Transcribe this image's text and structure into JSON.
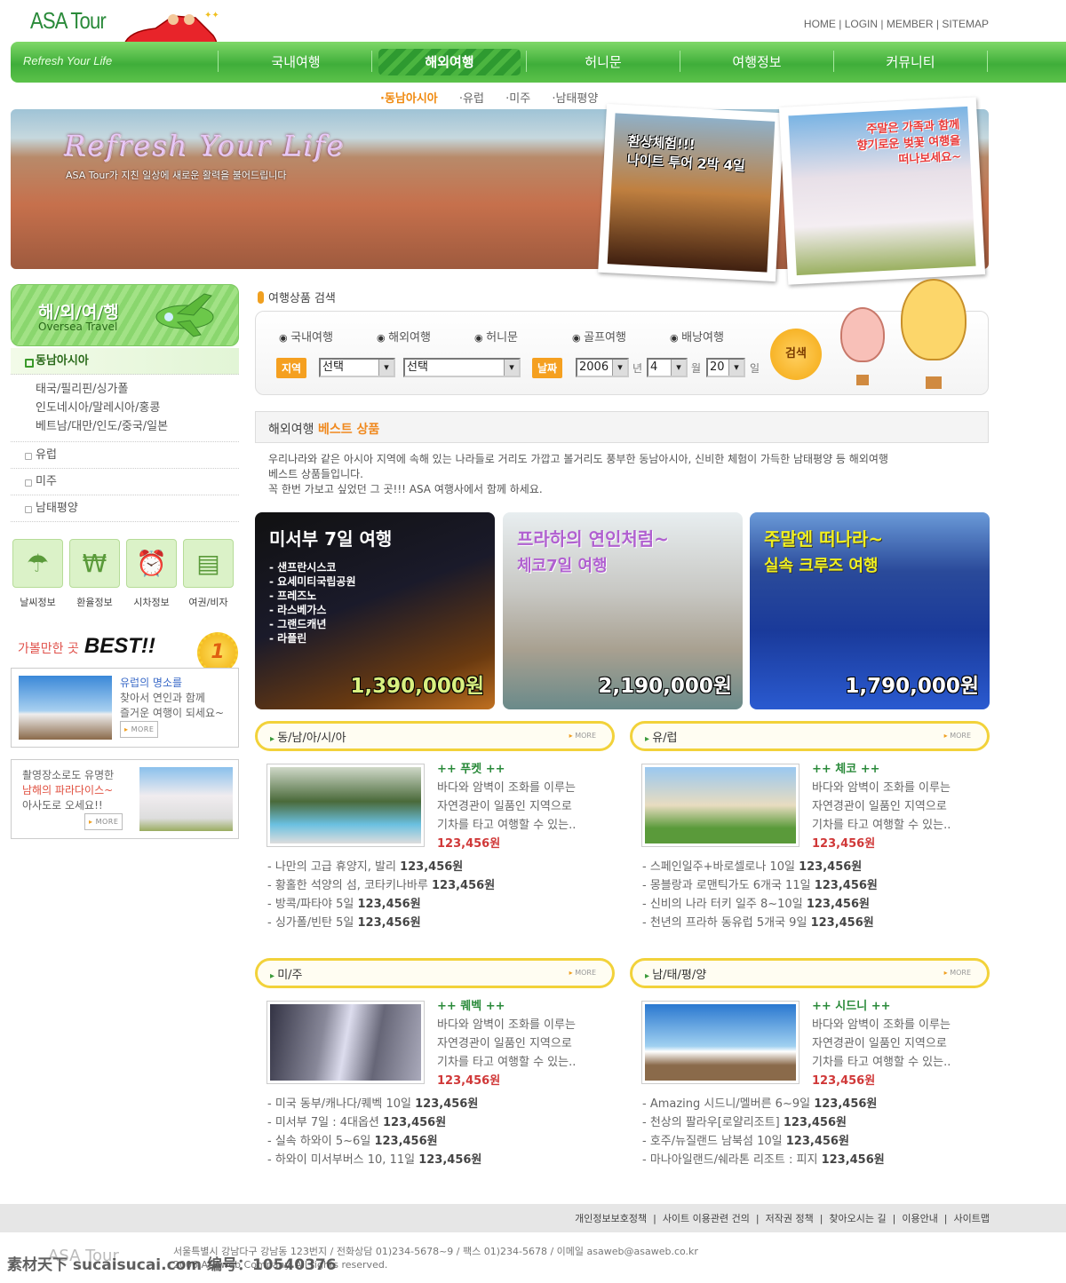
{
  "header": {
    "logo": "ASA Tour",
    "top_links": [
      "HOME",
      "LOGIN",
      "MEMBER",
      "SITEMAP"
    ]
  },
  "nav": {
    "tagline": "Refresh Your Life",
    "items": [
      "국내여행",
      "해외여행",
      "허니문",
      "여행정보",
      "커뮤니티"
    ],
    "active": "해외여행"
  },
  "subnav": [
    "동남아시아",
    "유럽",
    "미주",
    "남태평양"
  ],
  "banner": {
    "title": "Refresh Your Life",
    "subtitle": "ASA Tour가 지친 일상에 새로운 활력을 불어드립니다",
    "photo1": [
      "환상체험!!!",
      "나이트 투어 2박 4일"
    ],
    "photo2": [
      "주말은 가족과 함께",
      "향기로운 벚꽃 여행을",
      "떠나보세요~"
    ]
  },
  "sidebar": {
    "title_ko": "해/외/여/행",
    "title_en": "Oversea Travel",
    "menu": [
      {
        "label": "동남아시아",
        "active": true,
        "sub": [
          "태국/필리핀/싱가폴",
          "인도네시아/말레시아/홍콩",
          "베트남/대만/인도/중국/일본"
        ]
      },
      {
        "label": "유럽"
      },
      {
        "label": "미주"
      },
      {
        "label": "남태평양"
      }
    ],
    "tools": [
      {
        "label": "날씨정보",
        "icon": "umbrella-icon"
      },
      {
        "label": "환율정보",
        "icon": "won-icon"
      },
      {
        "label": "시차정보",
        "icon": "alarm-clock-icon"
      },
      {
        "label": "여권/비자",
        "icon": "passport-icon"
      }
    ],
    "best_title_ko": "가볼만한 곳",
    "best_title_en": "BEST!!",
    "medal": "1",
    "best_cards": [
      {
        "lines": [
          "유럽의 명소를",
          "찾아서 연인과 함께",
          "즐거운 여행이 되세요~"
        ],
        "more": "MORE"
      },
      {
        "lines": [
          "촬영장소로도 유명한",
          "남해의 파라다이스~",
          "아사도로 오세요!!"
        ],
        "more": "MORE"
      }
    ]
  },
  "search": {
    "title": "여행상품 검색",
    "radios": [
      "국내여행",
      "해외여행",
      "허니문",
      "골프여행",
      "배낭여행"
    ],
    "region_label": "지역",
    "region1": "선택",
    "region2": "선택",
    "date_label": "날짜",
    "year": "2006",
    "year_unit": "년",
    "month": "4",
    "month_unit": "월",
    "day": "20",
    "day_unit": "일",
    "button": "검색"
  },
  "best": {
    "title_a": "해외여행",
    "title_b": "베스트 상품",
    "desc": [
      "우리나라와 같은 아시아 지역에 속해 있는 나라들로 거리도 가깝고 볼거리도 풍부한 동남아시아, 신비한 체험이 가득한 남태평양 등 해외여행",
      "베스트 상품들입니다.",
      "꼭 한번 가보고 싶었던 그 곳!!! ASA 여행사에서 함께 하세요."
    ]
  },
  "cards": [
    {
      "title": "미서부 7일 여행",
      "lines": [
        "- 샌프란시스코",
        "- 요세미티국립공원",
        "- 프레즈노",
        "- 라스베가스",
        "- 그랜드캐년",
        "- 라플린"
      ],
      "price": "1,390,000원"
    },
    {
      "title": "프라하의 연인처럼~",
      "subtitle": "체코7일 여행",
      "price": "2,190,000원"
    },
    {
      "title": "주말엔 떠나라~",
      "subtitle": "실속 크루즈 여행",
      "price": "1,790,000원"
    }
  ],
  "regions": [
    {
      "name": "동/남/아/시/아",
      "more": "MORE",
      "spot": "++ 푸켓 ++",
      "desc": [
        "바다와 암벽이 조화를 이루는",
        "자연경관이 일품인 지역으로",
        "기차를 타고 여행할 수 있는.."
      ],
      "price": "123,456원",
      "list": [
        [
          "- 나만의 고급 휴양지, 발리",
          "123,456원"
        ],
        [
          "- 황홀한 석양의 섬, 코타키나바루",
          "123,456원"
        ],
        [
          "- 방콕/파타야 5일",
          "123,456원"
        ],
        [
          "- 싱가폴/빈탄 5일",
          "123,456원"
        ]
      ]
    },
    {
      "name": "유/럽",
      "more": "MORE",
      "spot": "++ 체코 ++",
      "desc": [
        "바다와 암벽이 조화를 이루는",
        "자연경관이 일품인 지역으로",
        "기차를 타고 여행할 수 있는.."
      ],
      "price": "123,456원",
      "list": [
        [
          "- 스페인일주+바로셀로나 10일",
          "123,456원"
        ],
        [
          "- 몽블랑과 로맨틱가도 6개국 11일",
          "123,456원"
        ],
        [
          "- 신비의 나라 터키 일주 8~10일",
          "123,456원"
        ],
        [
          "- 천년의 프라하 동유럽 5개국 9일",
          "123,456원"
        ]
      ]
    },
    {
      "name": "미/주",
      "more": "MORE",
      "spot": "++ 퀘벡 ++",
      "desc": [
        "바다와 암벽이 조화를 이루는",
        "자연경관이 일품인 지역으로",
        "기차를 타고 여행할 수 있는.."
      ],
      "price": "123,456원",
      "list": [
        [
          "- 미국 동부/캐나다/퀘벡 10일",
          "123,456원"
        ],
        [
          "- 미서부 7일 : 4대옵션",
          "123,456원"
        ],
        [
          "- 실속 하와이 5~6일",
          "123,456원"
        ],
        [
          "- 하와이 미서부버스 10, 11일",
          "123,456원"
        ]
      ]
    },
    {
      "name": "남/태/평/양",
      "more": "MORE",
      "spot": "++ 시드니 ++",
      "desc": [
        "바다와 암벽이 조화를 이루는",
        "자연경관이 일품인 지역으로",
        "기차를 타고 여행할 수 있는.."
      ],
      "price": "123,456원",
      "list": [
        [
          "- Amazing 시드니/멜버른 6~9일",
          "123,456원"
        ],
        [
          "- 천상의 팔라우[로얄리조트]",
          "123,456원"
        ],
        [
          "- 호주/뉴질랜드 남북섬 10일",
          "123,456원"
        ],
        [
          "- 마나아일랜드/쉐라톤 리조트 : 피지",
          "123,456원"
        ]
      ]
    }
  ],
  "footer": {
    "links": [
      "개인정보보호정책",
      "사이트 이용관련 건의",
      "저작권 정책",
      "찾아오시는 길",
      "이용안내",
      "사이트맵"
    ],
    "logo": "ASA Tour",
    "address": "서울특별시 강남다구 강남동 123번지 / 전화상담 01)234-5678~9 / 팩스 01)234-5678 / 이메일 asaweb@asaweb.co.kr",
    "copyright": "2006 ASAweb Company. All rights reserved.",
    "watermark": "素材天下 sucaisucai.com  编号：10540376"
  },
  "colors": {
    "nav_green": "#3fae3a",
    "accent_orange": "#f5a020",
    "price_red": "#d03838",
    "spot_green": "#2a8a3a"
  }
}
